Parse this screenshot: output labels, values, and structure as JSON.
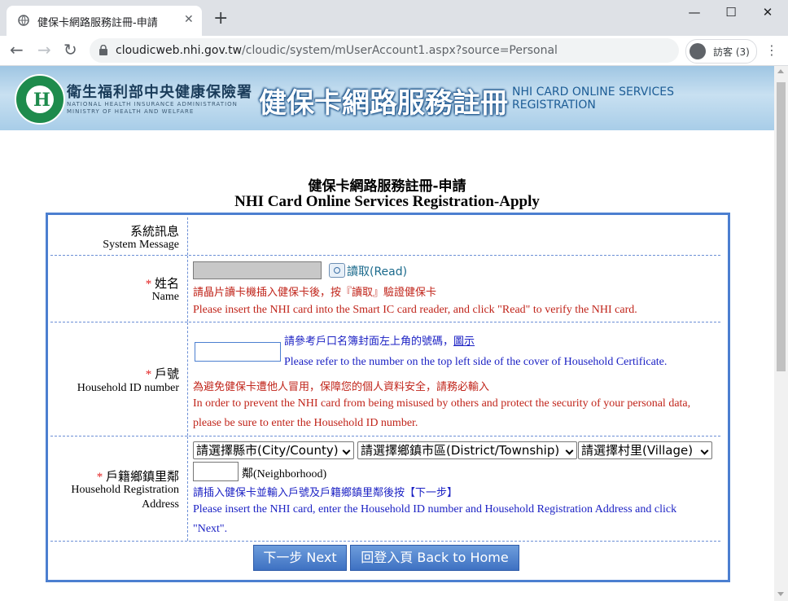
{
  "browser": {
    "tab_title": "健保卡網路服務註冊-申請",
    "tab_close": "✕",
    "new_tab": "+",
    "url_host": "cloudicweb.nhi.gov.tw",
    "url_path": "/cloudic/system/mUserAccount1.aspx?source=Personal",
    "profile_label": "訪客 (3)",
    "window_controls": [
      "—",
      "☐",
      "✕"
    ]
  },
  "banner": {
    "agency_zh": "衛生福利部中央健康保險署",
    "agency_en_line1": "NATIONAL HEALTH INSURANCE ADMINISTRATION",
    "agency_en_line2": "MINISTRY OF HEALTH AND WELFARE",
    "service_zh": "健保卡網路服務註冊",
    "service_en_line1": "NHI CARD ONLINE SERVICES",
    "service_en_line2": "REGISTRATION"
  },
  "page": {
    "title_zh": "健保卡網路服務註冊-申請",
    "title_en": "NHI Card Online Services Registration-Apply"
  },
  "form": {
    "system_message": {
      "label_zh": "系統訊息",
      "label_en": "System Message",
      "value": ""
    },
    "name": {
      "required_mark": "*",
      "label_zh": "姓名",
      "label_en": "Name",
      "value": "",
      "read_button": "讀取(Read)",
      "hint_zh": "請晶片讀卡機插入健保卡後，按『讀取』驗證健保卡",
      "hint_en": "Please insert the NHI card into the Smart IC card reader, and click \"Read\" to verify the NHI card."
    },
    "household_id": {
      "required_mark": "*",
      "label_zh": "戶號",
      "label_en": "Household ID number",
      "value": "",
      "ref_zh": "請參考戶口名簿封面左上角的號碼，",
      "ref_link": "圖示",
      "ref_en": "Please refer to the number on the top left side of the cover of Household Certificate.",
      "warn_zh": "為避免健保卡遭他人冒用，保障您的個人資料安全，請務必輸入",
      "warn_en_line1": "In order to prevent the NHI card from being misused by others and protect the security of your personal data,",
      "warn_en_line2": "please be sure to enter the Household ID number."
    },
    "address": {
      "required_mark": "*",
      "label_zh": "戶籍鄉鎮里鄰",
      "label_en_line1": "Household Registration",
      "label_en_line2": "Address",
      "city_select": "請選擇縣市(City/County)",
      "district_select": "請選擇鄉鎮市區(District/Township)",
      "village_select": "請選擇村里(Village)",
      "neighborhood_value": "",
      "neighborhood_suffix": "鄰(Neighborhood)",
      "hint_zh": "請插入健保卡並輸入戶號及戶籍鄉鎮里鄰後按【下一步】",
      "hint_en_line1": "Please insert the NHI card, enter the Household ID number and Household Registration Address and click",
      "hint_en_line2": "\"Next\"."
    }
  },
  "buttons": {
    "next": "下一步 Next",
    "home": "回登入頁 Back to Home"
  }
}
